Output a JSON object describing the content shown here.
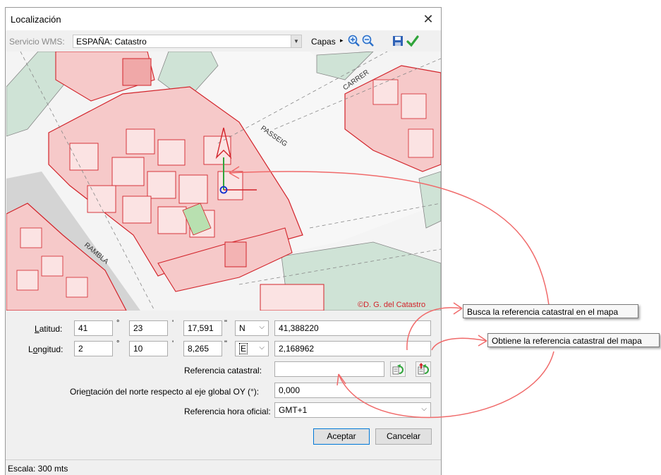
{
  "window": {
    "title": "Localización",
    "close_glyph": "✕"
  },
  "toolbar": {
    "wms_label": "Servicio WMS:",
    "wms_value": "ESPAÑA: Catastro",
    "capas_label": "Capas",
    "icons": [
      "zoom-in-icon",
      "zoom-out-icon",
      "save-icon",
      "check-icon"
    ]
  },
  "map": {
    "copyright": "©D. G. del Catastro",
    "street_labels": [
      "CARRER",
      "PASSEIG",
      "RAMBLA"
    ]
  },
  "form": {
    "latitude": {
      "label_underline": "L",
      "label_rest": "atitud:",
      "deg": "41",
      "min": "23",
      "sec": "17,591",
      "hemi": "N",
      "decimal": "41,388220"
    },
    "longitude": {
      "label_pre": "L",
      "label_underline": "o",
      "label_rest": "ngitud:",
      "deg": "2",
      "min": "10",
      "sec": "8,265",
      "hemi": "E",
      "decimal": "2,168962"
    },
    "deg_mark": "°",
    "min_mark": "'",
    "sec_mark": "\"",
    "cadastral_label": "Referencia catastral:",
    "cadastral_value": "",
    "orientation_label_pre": "Orie",
    "orientation_label_underline": "n",
    "orientation_label_rest": "tación del norte respecto al eje global OY (°):",
    "orientation_value": "0,000",
    "time_label": "Referencia hora oficial:",
    "time_value": "GMT+1"
  },
  "buttons": {
    "accept": "Aceptar",
    "cancel": "Cancelar"
  },
  "status": {
    "scale": "Escala: 300 mts"
  },
  "tooltips": {
    "search": "Busca la referencia catastral en el mapa",
    "obtain": "Obtiene la referencia catastral del mapa"
  },
  "colors": {
    "parcel_fill": "#f6c9c9",
    "parcel_stroke": "#d2232a",
    "green_area": "#cfe3d6",
    "annotation": "#f06a6a"
  }
}
